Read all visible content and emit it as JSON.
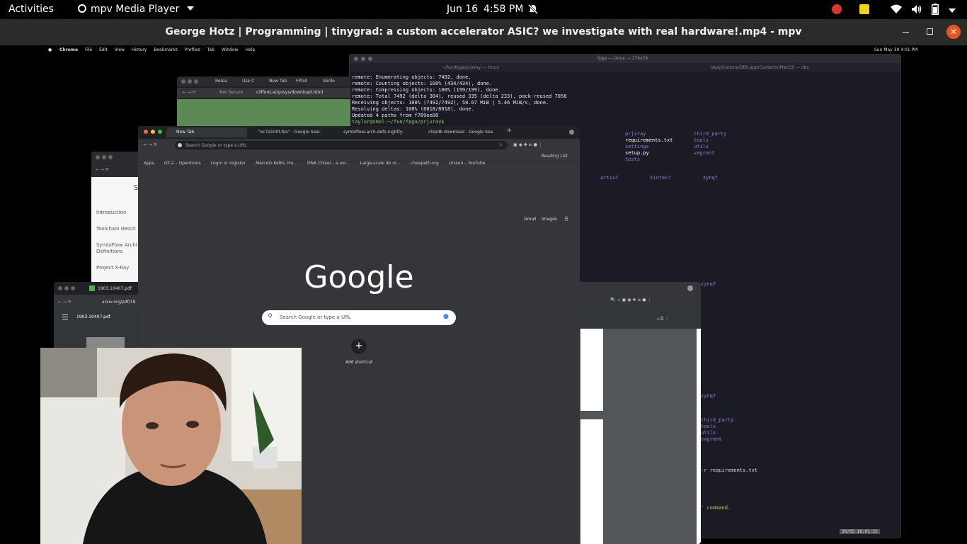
{
  "topbar": {
    "activities": "Activities",
    "app_menu": "mpv Media Player",
    "date": "Jun 16",
    "time": "4:58 PM"
  },
  "titlebar": {
    "title": "George Hotz | Programming | tinygrad: a custom accelerator ASIC? we investigate with real hardware!.mp4 - mpv"
  },
  "mac_menubar": {
    "items": [
      "Chrome",
      "File",
      "Edit",
      "View",
      "History",
      "Bookmarks",
      "Profiles",
      "Tab",
      "Window",
      "Help"
    ],
    "clock": "Sun May 30  4:01 PM"
  },
  "terminal": {
    "title": "fpga — tmux — 174x74",
    "path_left": "~/fun/fpga/prjxray — tmux",
    "path_right": "/Applications/OBS.app/Contents/MacOS — obs",
    "lines": [
      "remote: Enumerating objects: 7492, done.",
      "remote: Counting objects: 100% (434/434), done.",
      "remote: Compressing objects: 100% (199/199), done.",
      "remote: Total 7492 (delta 304), reused 335 (delta 233), pack-reused 7058",
      "Receiving objects: 100% (7492/7492), 58.67 MiB | 5.46 MiB/s, done.",
      "Resolving deltas: 100% (6018/6018), done.",
      "Updated 4 paths from f789ee00",
      "taylor@smol:~/fun/fpga/prjxray$"
    ],
    "ls_col1": [
      "prjxray",
      "requirements.txt",
      "settings",
      "setup.py",
      "tests"
    ],
    "ls_col2": [
      "third_party",
      "tools",
      "utils",
      "vagrant"
    ],
    "dirs": [
      "artix7",
      "kintex7",
      "zynq7"
    ],
    "frag_zynq_a": "zynq7",
    "frag_zynq_b": "zynq7",
    "frag_list": [
      "third_party",
      "tools",
      "utils",
      "vagrant"
    ],
    "pip_line": "-r requirements.txt",
    "command_line": "' command.",
    "status": "30/05  16:01:32"
  },
  "browser_back": {
    "tabs": [
      "Relea",
      "Use C",
      "New Tab",
      "FPGA",
      "Verilo"
    ],
    "security": "Not Secure",
    "url": "clifford.at/yosys/download.html"
  },
  "chrome": {
    "tabs": [
      "New Tab",
      "\"xc7a100t.bin\" - Google Sear",
      "symbiflow-arch-defs-nightly-",
      "chipdb download - Google Sea"
    ],
    "omnibox_placeholder": "Search Google or type a URL",
    "bookmarks": [
      "Apps",
      "OT-2 – Opentrons",
      "Login or register",
      "Marcelo Kellis: Hu...",
      "DNA Chisel – a ver...",
      "Large-scale de ro...",
      "cheapeth.org",
      "Unison – YouTube"
    ],
    "reading_list": "Reading List",
    "gmail": "Gmail",
    "images": "Images",
    "logo": "Google",
    "search_placeholder": "Search Google or type a URL",
    "add_shortcut": "Add shortcut"
  },
  "docs_window": {
    "heading": "S",
    "items": [
      "Introduction",
      "Toolchain descri",
      "SymbiFlow Archi Definitions",
      "Project X-Ray"
    ]
  },
  "pdf_window": {
    "tab": "1903.10407.pdf",
    "url": "arxiv.org/pdf/19",
    "doc_title": "1903.10407.pdf"
  },
  "colors": {
    "topbar": "#000000",
    "titlebar": "#2b2b2b",
    "close": "#e95420",
    "terminal_bg": "#1b1b26",
    "chrome_bg": "#35363a",
    "prompt_green": "#7ed957",
    "purple": "#9b7bd6"
  }
}
